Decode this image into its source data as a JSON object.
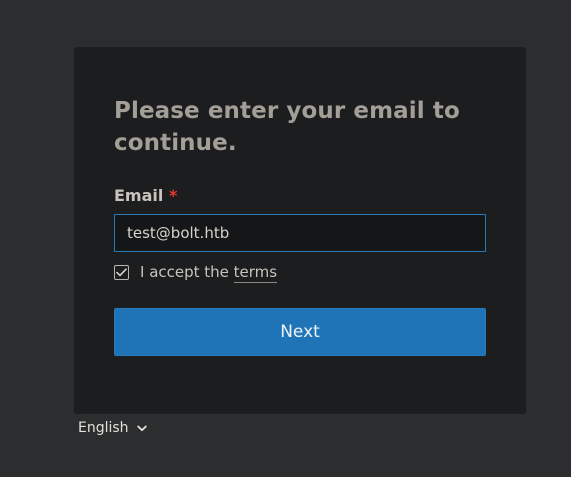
{
  "form": {
    "heading": "Please enter your email to continue.",
    "email_label": "Email",
    "required_mark": "*",
    "email_value": "test@bolt.htb",
    "accept_prefix": "I accept the ",
    "terms_link": "terms",
    "accept_checked": true,
    "next_label": "Next"
  },
  "language": {
    "selected": "English"
  },
  "colors": {
    "page_background": "#2b2d2f",
    "card_background": "#1c1d1f",
    "accent": "#1f73b7",
    "required": "#e23b32"
  },
  "icons": {
    "checkbox": "check-icon",
    "language_dropdown": "chevron-down-icon"
  }
}
